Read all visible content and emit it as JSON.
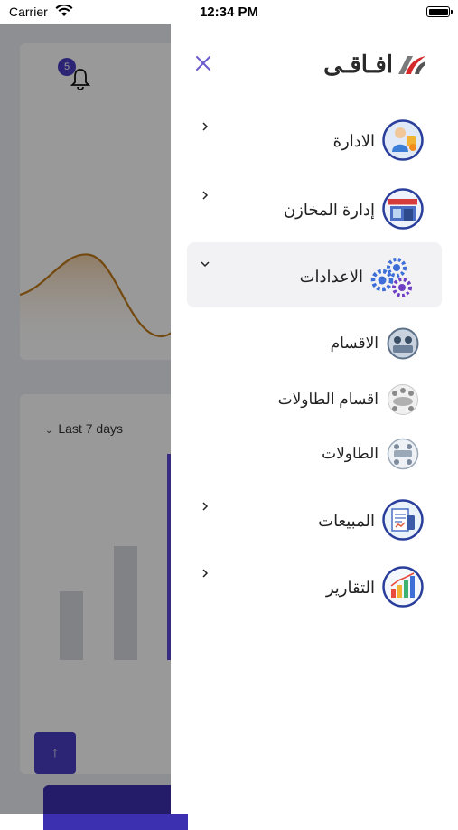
{
  "status_bar": {
    "carrier": "Carrier",
    "time": "12:34 PM"
  },
  "background": {
    "notification_count": "5",
    "date_range": "Last 7 days",
    "up_icon": "↑"
  },
  "drawer": {
    "brand": "افـاقـى",
    "close_icon": "close-icon",
    "items": [
      {
        "label": "الادارة",
        "icon": "admin-person-icon",
        "expanded": false
      },
      {
        "label": "إدارة المخازن",
        "icon": "store-icon",
        "expanded": false
      },
      {
        "label": "الاعدادات",
        "icon": "settings-gears-icon",
        "expanded": true
      },
      {
        "label": "المبيعات",
        "icon": "sales-icon",
        "expanded": false
      },
      {
        "label": "التقارير",
        "icon": "reports-chart-icon",
        "expanded": false
      }
    ],
    "sub_items": [
      {
        "label": "الاقسام",
        "icon": "sections-icon"
      },
      {
        "label": "اقسام الطاولات",
        "icon": "table-sections-icon"
      },
      {
        "label": "الطاولات",
        "icon": "tables-icon"
      }
    ]
  },
  "colors": {
    "accent": "#4a3fc4",
    "chart_line": "#c07a1a",
    "close_icon": "#6a5acd"
  }
}
